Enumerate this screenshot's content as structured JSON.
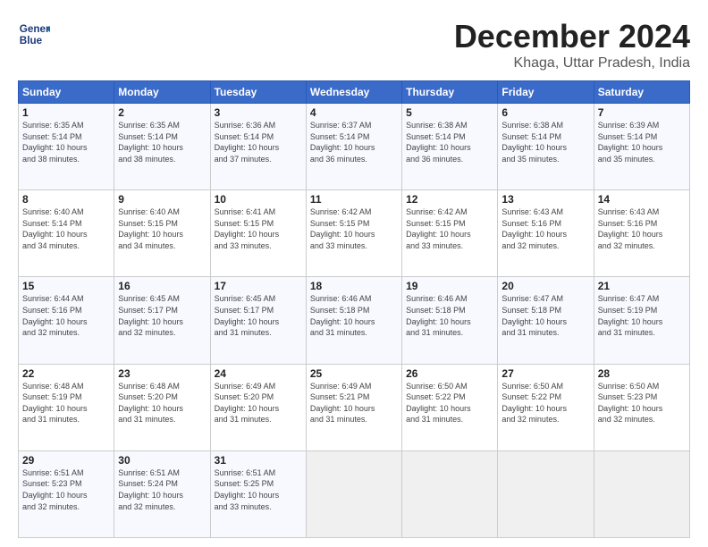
{
  "logo": {
    "line1": "General",
    "line2": "Blue"
  },
  "title": "December 2024",
  "subtitle": "Khaga, Uttar Pradesh, India",
  "headers": [
    "Sunday",
    "Monday",
    "Tuesday",
    "Wednesday",
    "Thursday",
    "Friday",
    "Saturday"
  ],
  "weeks": [
    [
      {
        "day": "1",
        "info": "Sunrise: 6:35 AM\nSunset: 5:14 PM\nDaylight: 10 hours\nand 38 minutes."
      },
      {
        "day": "2",
        "info": "Sunrise: 6:35 AM\nSunset: 5:14 PM\nDaylight: 10 hours\nand 38 minutes."
      },
      {
        "day": "3",
        "info": "Sunrise: 6:36 AM\nSunset: 5:14 PM\nDaylight: 10 hours\nand 37 minutes."
      },
      {
        "day": "4",
        "info": "Sunrise: 6:37 AM\nSunset: 5:14 PM\nDaylight: 10 hours\nand 36 minutes."
      },
      {
        "day": "5",
        "info": "Sunrise: 6:38 AM\nSunset: 5:14 PM\nDaylight: 10 hours\nand 36 minutes."
      },
      {
        "day": "6",
        "info": "Sunrise: 6:38 AM\nSunset: 5:14 PM\nDaylight: 10 hours\nand 35 minutes."
      },
      {
        "day": "7",
        "info": "Sunrise: 6:39 AM\nSunset: 5:14 PM\nDaylight: 10 hours\nand 35 minutes."
      }
    ],
    [
      {
        "day": "8",
        "info": "Sunrise: 6:40 AM\nSunset: 5:14 PM\nDaylight: 10 hours\nand 34 minutes."
      },
      {
        "day": "9",
        "info": "Sunrise: 6:40 AM\nSunset: 5:15 PM\nDaylight: 10 hours\nand 34 minutes."
      },
      {
        "day": "10",
        "info": "Sunrise: 6:41 AM\nSunset: 5:15 PM\nDaylight: 10 hours\nand 33 minutes."
      },
      {
        "day": "11",
        "info": "Sunrise: 6:42 AM\nSunset: 5:15 PM\nDaylight: 10 hours\nand 33 minutes."
      },
      {
        "day": "12",
        "info": "Sunrise: 6:42 AM\nSunset: 5:15 PM\nDaylight: 10 hours\nand 33 minutes."
      },
      {
        "day": "13",
        "info": "Sunrise: 6:43 AM\nSunset: 5:16 PM\nDaylight: 10 hours\nand 32 minutes."
      },
      {
        "day": "14",
        "info": "Sunrise: 6:43 AM\nSunset: 5:16 PM\nDaylight: 10 hours\nand 32 minutes."
      }
    ],
    [
      {
        "day": "15",
        "info": "Sunrise: 6:44 AM\nSunset: 5:16 PM\nDaylight: 10 hours\nand 32 minutes."
      },
      {
        "day": "16",
        "info": "Sunrise: 6:45 AM\nSunset: 5:17 PM\nDaylight: 10 hours\nand 32 minutes."
      },
      {
        "day": "17",
        "info": "Sunrise: 6:45 AM\nSunset: 5:17 PM\nDaylight: 10 hours\nand 31 minutes."
      },
      {
        "day": "18",
        "info": "Sunrise: 6:46 AM\nSunset: 5:18 PM\nDaylight: 10 hours\nand 31 minutes."
      },
      {
        "day": "19",
        "info": "Sunrise: 6:46 AM\nSunset: 5:18 PM\nDaylight: 10 hours\nand 31 minutes."
      },
      {
        "day": "20",
        "info": "Sunrise: 6:47 AM\nSunset: 5:18 PM\nDaylight: 10 hours\nand 31 minutes."
      },
      {
        "day": "21",
        "info": "Sunrise: 6:47 AM\nSunset: 5:19 PM\nDaylight: 10 hours\nand 31 minutes."
      }
    ],
    [
      {
        "day": "22",
        "info": "Sunrise: 6:48 AM\nSunset: 5:19 PM\nDaylight: 10 hours\nand 31 minutes."
      },
      {
        "day": "23",
        "info": "Sunrise: 6:48 AM\nSunset: 5:20 PM\nDaylight: 10 hours\nand 31 minutes."
      },
      {
        "day": "24",
        "info": "Sunrise: 6:49 AM\nSunset: 5:20 PM\nDaylight: 10 hours\nand 31 minutes."
      },
      {
        "day": "25",
        "info": "Sunrise: 6:49 AM\nSunset: 5:21 PM\nDaylight: 10 hours\nand 31 minutes."
      },
      {
        "day": "26",
        "info": "Sunrise: 6:50 AM\nSunset: 5:22 PM\nDaylight: 10 hours\nand 31 minutes."
      },
      {
        "day": "27",
        "info": "Sunrise: 6:50 AM\nSunset: 5:22 PM\nDaylight: 10 hours\nand 32 minutes."
      },
      {
        "day": "28",
        "info": "Sunrise: 6:50 AM\nSunset: 5:23 PM\nDaylight: 10 hours\nand 32 minutes."
      }
    ],
    [
      {
        "day": "29",
        "info": "Sunrise: 6:51 AM\nSunset: 5:23 PM\nDaylight: 10 hours\nand 32 minutes."
      },
      {
        "day": "30",
        "info": "Sunrise: 6:51 AM\nSunset: 5:24 PM\nDaylight: 10 hours\nand 32 minutes."
      },
      {
        "day": "31",
        "info": "Sunrise: 6:51 AM\nSunset: 5:25 PM\nDaylight: 10 hours\nand 33 minutes."
      },
      {
        "day": "",
        "info": ""
      },
      {
        "day": "",
        "info": ""
      },
      {
        "day": "",
        "info": ""
      },
      {
        "day": "",
        "info": ""
      }
    ]
  ]
}
